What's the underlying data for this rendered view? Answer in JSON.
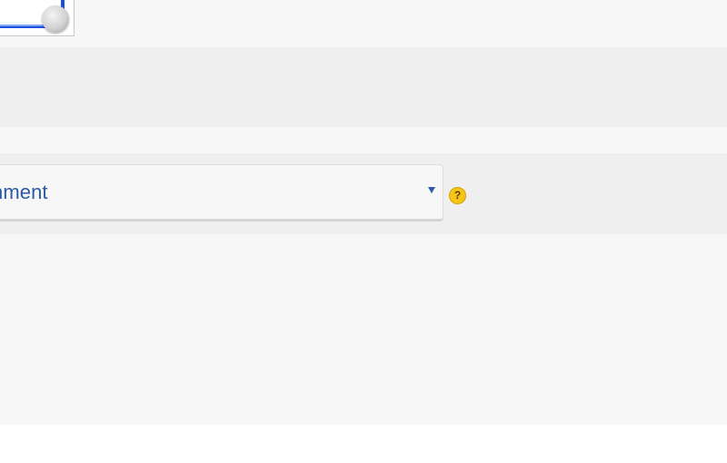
{
  "select": {
    "value": "nment"
  },
  "help": {
    "glyph": "?"
  },
  "colors": {
    "accent": "#2a5aa8",
    "help_badge": "#f5c518",
    "thumbnail_frame": "#1a4fe0"
  },
  "icons": {
    "thumbnail": "toggle-switch-image",
    "dropdown": "triangle-down-icon",
    "help": "question-circle-icon"
  }
}
